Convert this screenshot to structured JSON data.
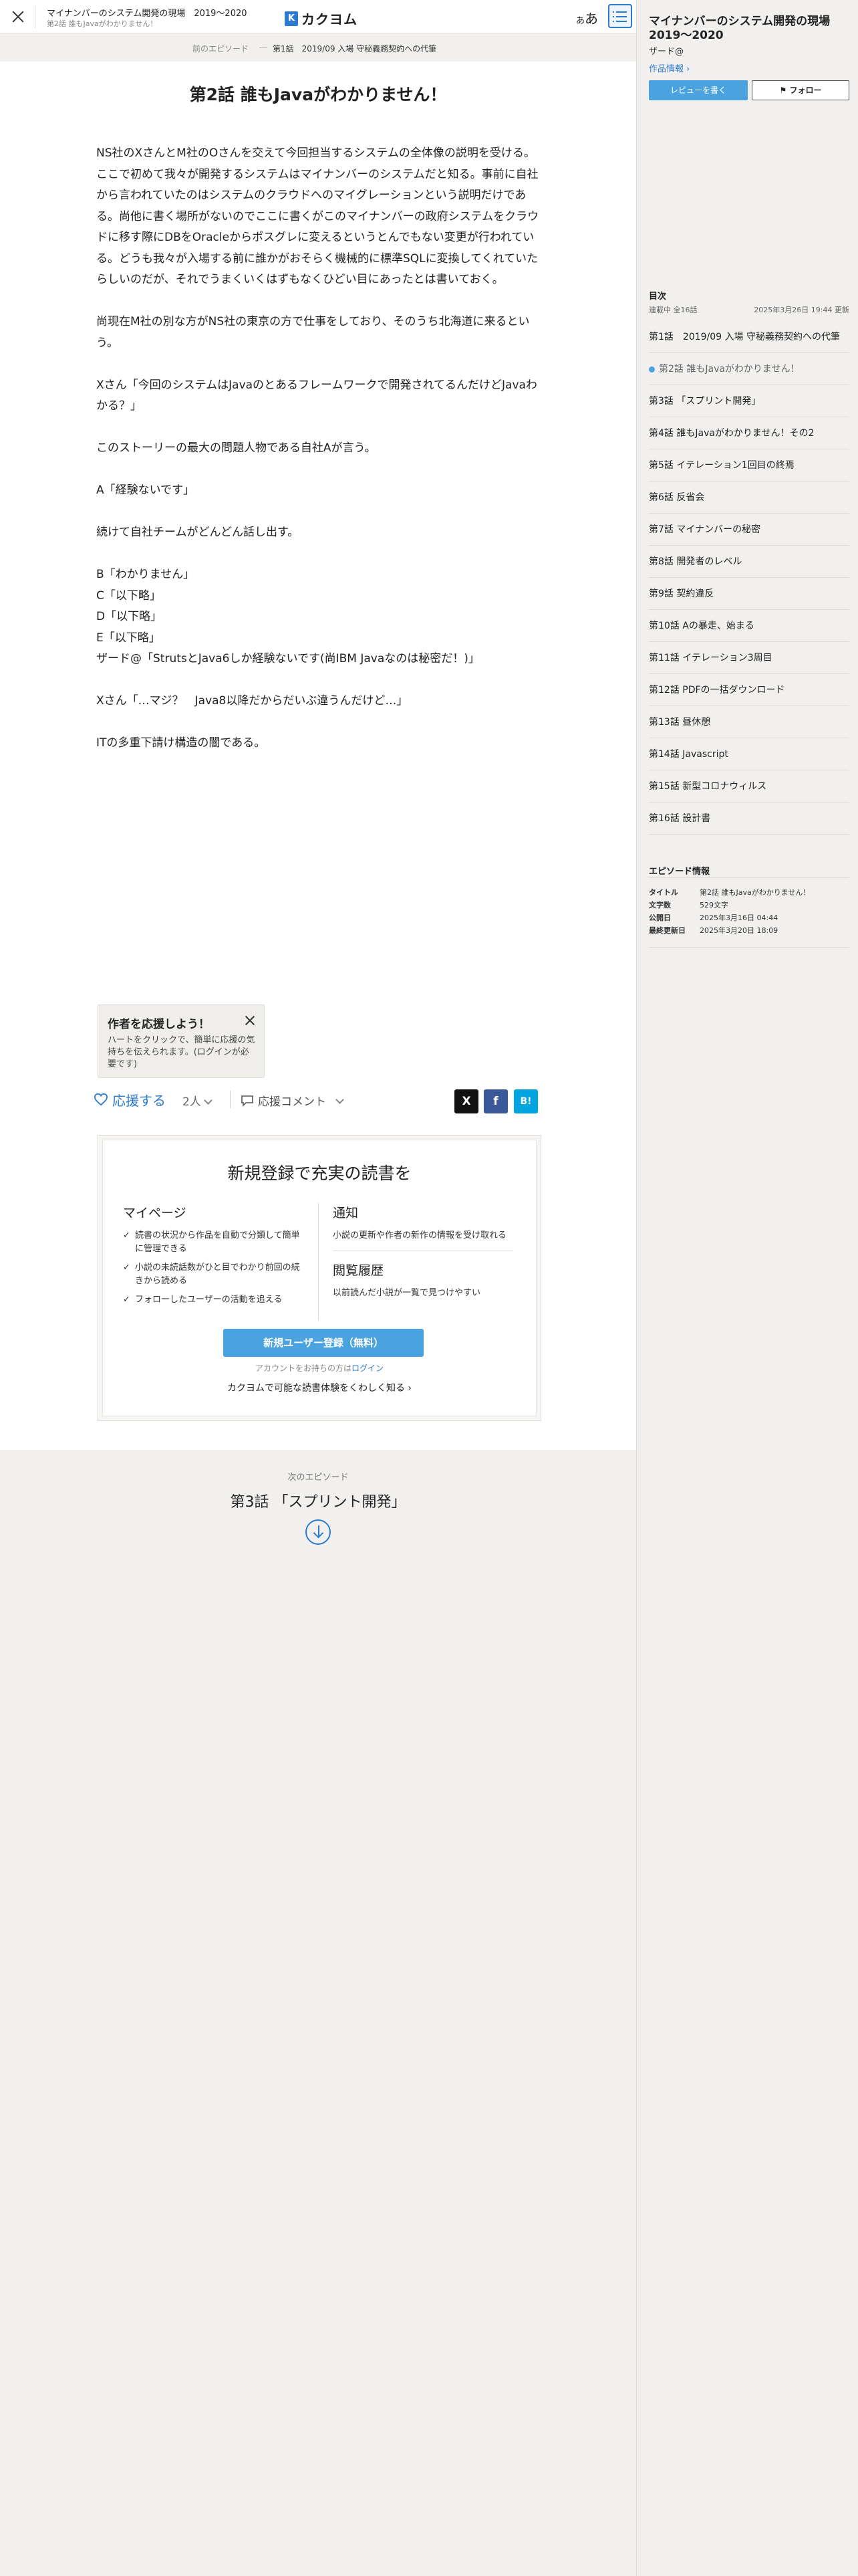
{
  "header": {
    "work_title": "マイナンバーのシステム開発の現場　2019〜2020",
    "episode_subtitle": "第2話 誰もJavaがわかりません！",
    "logo_mark": "K",
    "logo_text": "カクヨム",
    "font_toggle_small": "あ",
    "font_toggle_large": "あ"
  },
  "breadcrumb": {
    "prev_label": "前のエピソード",
    "separator": "―",
    "prev_episode": "第1話　2019/09 入場 守秘義務契約への代筆"
  },
  "episode": {
    "title": "第2話 誰もJavaがわかりません！",
    "paragraphs": [
      "NS社のXさんとM社のOさんを交えて今回担当するシステムの全体像の説明を受ける。ここで初めて我々が開発するシステムはマイナンバーのシステムだと知る。事前に自社から言われていたのはシステムのクラウドへのマイグレーションという説明だけである。尚他に書く場所がないのでここに書くがこのマイナンバーの政府システムをクラウドに移す際にDBをOracleからポスグレに変えるというとんでもない変更が行われている。どうも我々が入場する前に誰かがおそらく機械的に標準SQLに変換してくれていたらしいのだが、それでうまくいくはずもなくひどい目にあったとは書いておく。",
      "",
      "尚現在M社の別な方がNS社の東京の方で仕事をしており、そのうち北海道に来るという。",
      "",
      "Xさん「今回のシステムはJavaのとあるフレームワークで開発されてるんだけどJavaわかる？」",
      "",
      "このストーリーの最大の問題人物である自社Aが言う。",
      "",
      "A「経験ないです」",
      "",
      "続けて自社チームがどんどん話し出す。",
      "",
      "B「わかりません」",
      "C「以下略」",
      "D「以下略」",
      "E「以下略」",
      "ザード@「StrutsとJava6しか経験ないです(尚IBM Javaなのは秘密だ！)」",
      "",
      "Xさん「…マジ？　Java8以降だからだいぶ違うんだけど…」",
      "",
      "ITの多重下請け構造の闇である。"
    ]
  },
  "support_card": {
    "title": "作者を応援しよう！",
    "description": "ハートをクリックで、簡単に応援の気持ちを伝えられます。(ログインが必要です)"
  },
  "actions": {
    "support_label": "応援する",
    "support_count": "2人",
    "comment_label": "応援コメント",
    "share_x": "X",
    "share_fb": "f",
    "share_hb": "B!"
  },
  "signup": {
    "title": "新規登録で充実の読書を",
    "mypage_heading": "マイページ",
    "mypage_items": [
      "読書の状況から作品を自動で分類して簡単に管理できる",
      "小説の未読話数がひと目でわかり前回の続きから読める",
      "フォローしたユーザーの活動を追える"
    ],
    "notify_heading": "通知",
    "notify_text": "小説の更新や作者の新作の情報を受け取れる",
    "history_heading": "閲覧履歴",
    "history_text": "以前読んだ小説が一覧で見つけやすい",
    "register_button": "新規ユーザー登録（無料）",
    "login_prefix": "アカウントをお持ちの方は",
    "login_link": "ログイン",
    "more_link": "カクヨムで可能な読書体験をくわしく知る"
  },
  "next_episode": {
    "label": "次のエピソード",
    "title": "第3話 「スプリント開発」"
  },
  "sidebar": {
    "work_title": "マイナンバーのシステム開発の現場　2019〜2020",
    "author": "ザード@",
    "info_link": "作品情報",
    "review_button": "レビューを書く",
    "follow_button": "フォロー",
    "toc_heading": "目次",
    "toc_status": "連載中 全16話",
    "toc_updated": "2025年3月26日 19:44 更新",
    "toc_items": [
      "第1話　2019/09 入場 守秘義務契約への代筆",
      "第2話 誰もJavaがわかりません！",
      "第3話 「スプリント開発」",
      "第4話 誰もJavaがわかりません！その2",
      "第5話 イテレーション1回目の終焉",
      "第6話 反省会",
      "第7話 マイナンバーの秘密",
      "第8話 開発者のレベル",
      "第9話 契約違反",
      "第10話 Aの暴走、始まる",
      "第11話 イテレーション3周目",
      "第12話 PDFの一括ダウンロード",
      "第13話 昼休憩",
      "第14話 Javascript",
      "第15話 新型コロナウィルス",
      "第16話 設計書"
    ],
    "current_index": 1,
    "episode_info": {
      "heading": "エピソード情報",
      "rows": [
        {
          "k": "タイトル",
          "v": "第2話 誰もJavaがわかりません！"
        },
        {
          "k": "文字数",
          "v": "529文字"
        },
        {
          "k": "公開日",
          "v": "2025年3月16日 04:44"
        },
        {
          "k": "最終更新日",
          "v": "2025年3月20日 18:09"
        }
      ]
    }
  },
  "colors": {
    "accent": "#4aa3df",
    "link": "#2b7bd0",
    "background": "#f1f0ee"
  }
}
